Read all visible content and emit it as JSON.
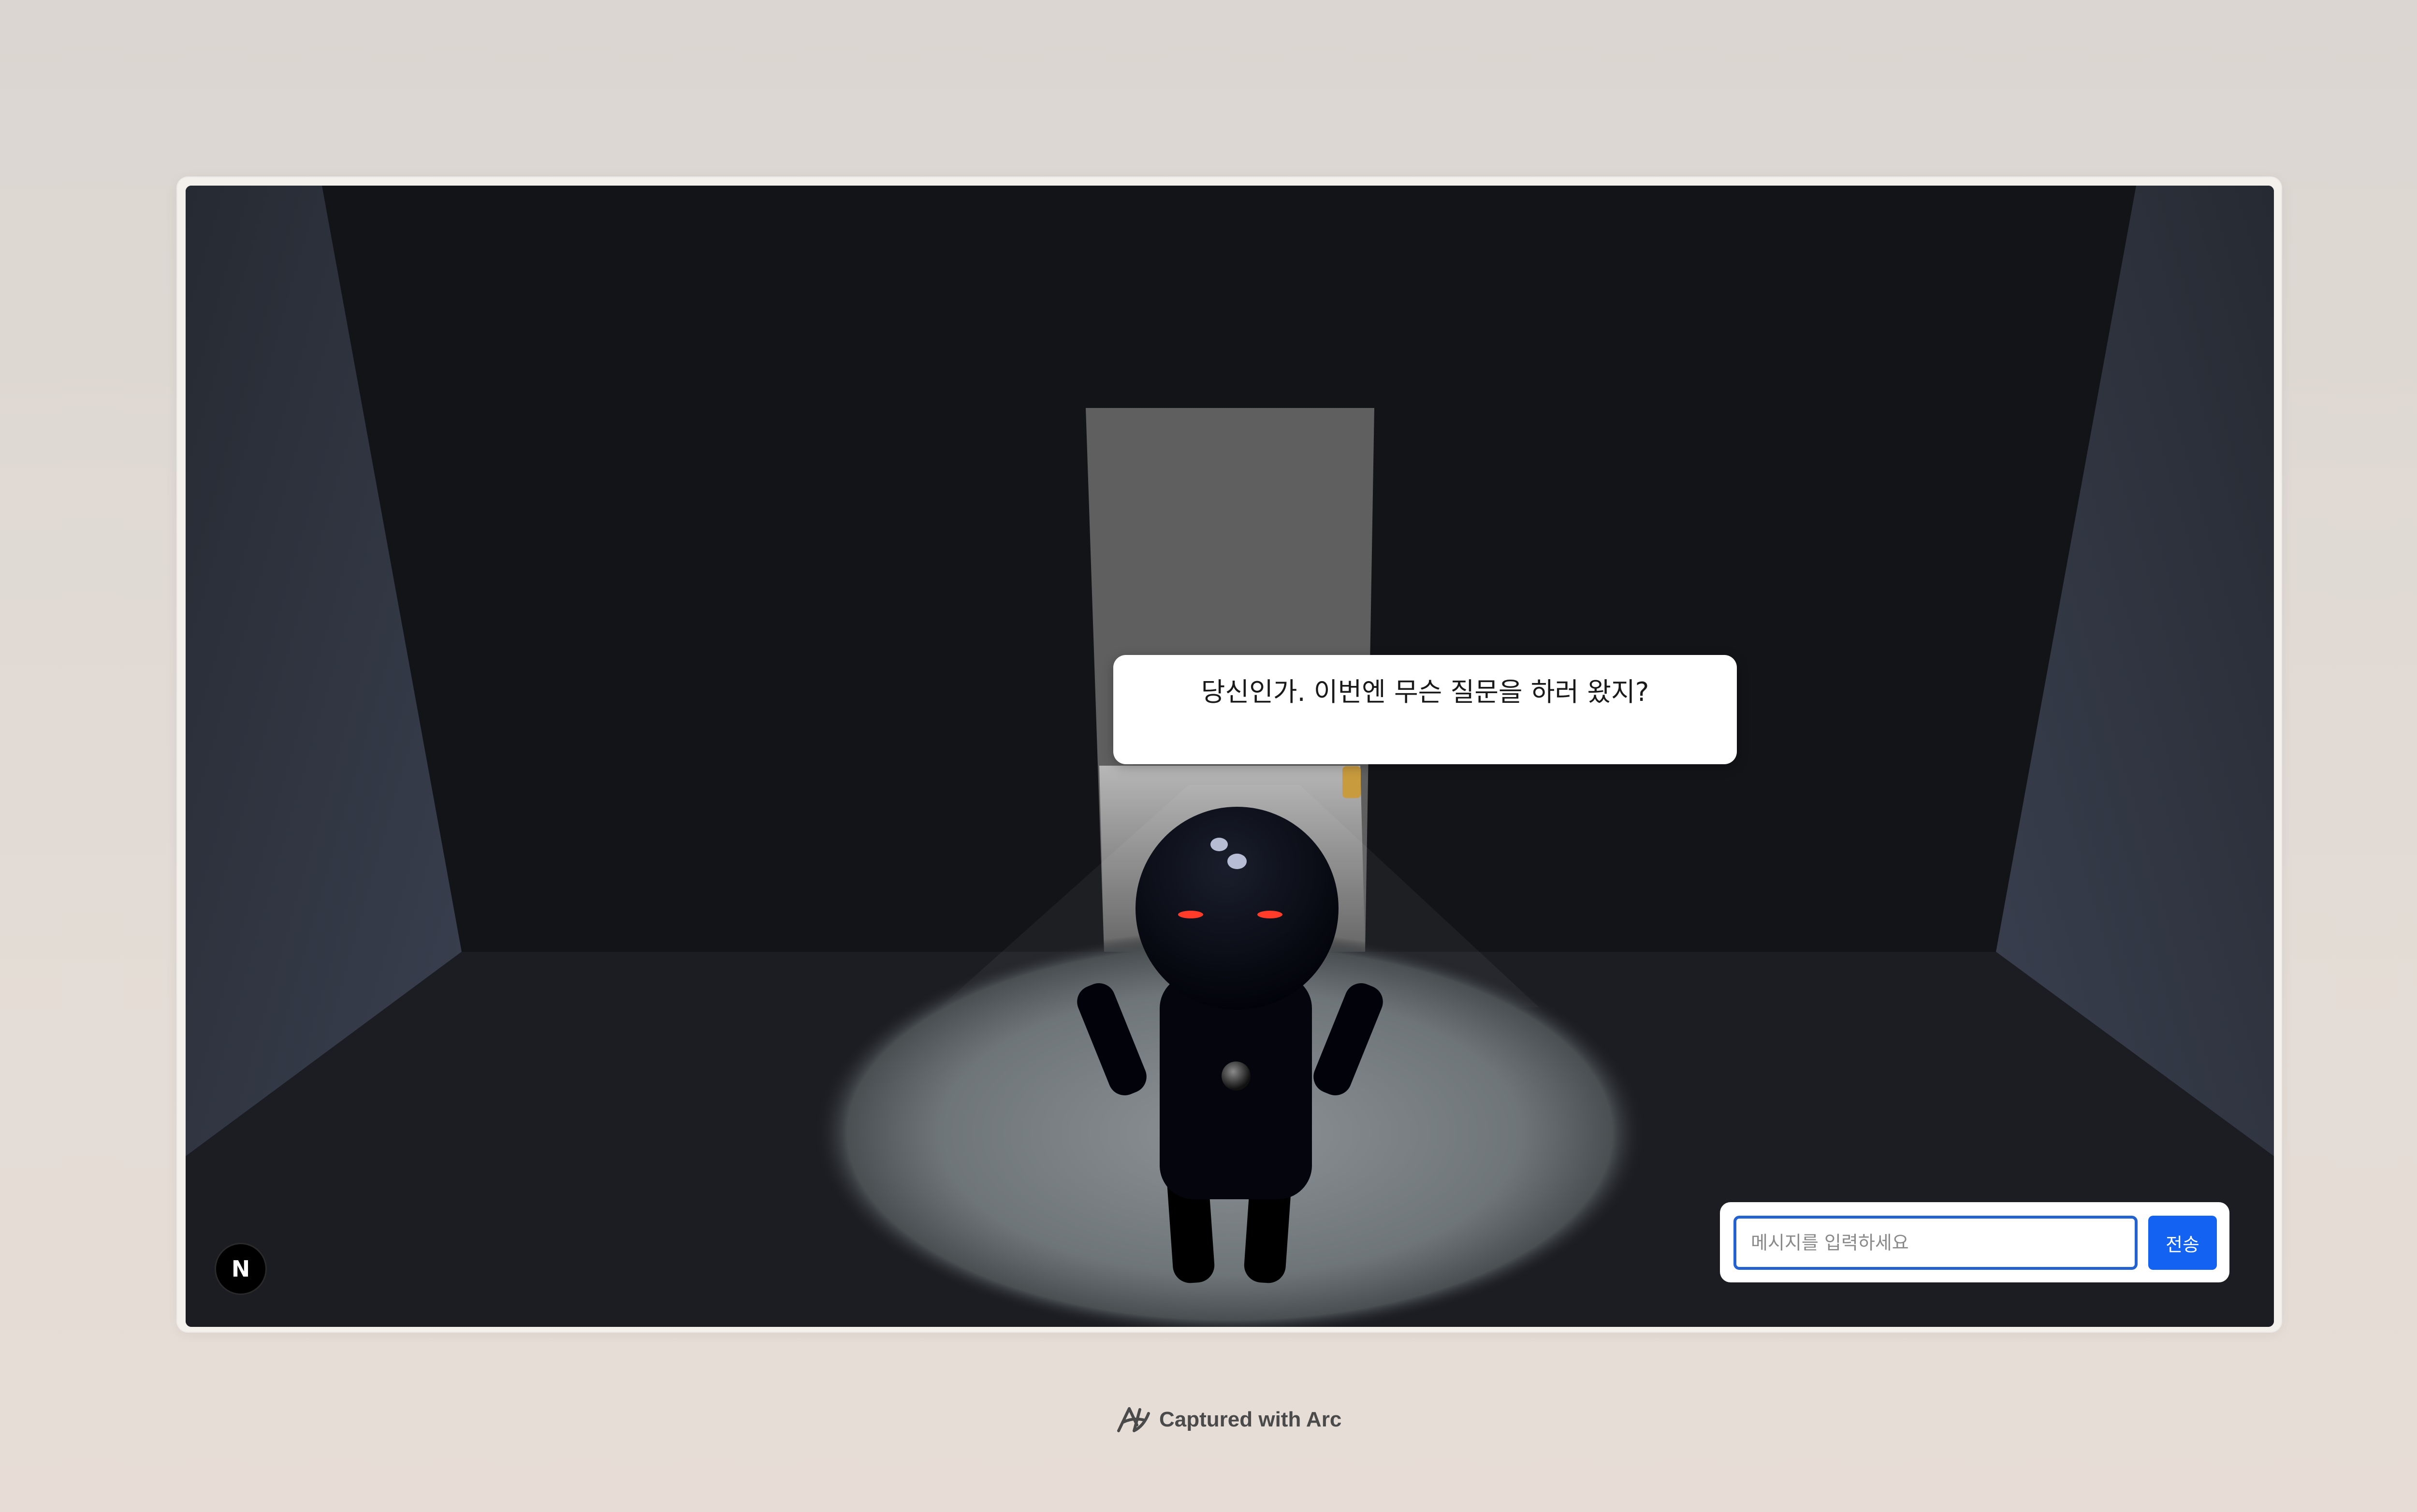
{
  "scene": {
    "dialogue": "당신인가. 이번엔 무슨 질문을 하러 왔지?",
    "logo_badge": "N"
  },
  "chat": {
    "input_value": "",
    "input_placeholder": "메시지를 입력하세요",
    "send_label": "전송"
  },
  "footer": {
    "credit": "Captured with Arc",
    "icon": "arc-logo-icon"
  },
  "colors": {
    "send_button": "#1462f1",
    "input_border": "#2463cf",
    "robot_eyes": "#ff3b2a"
  }
}
